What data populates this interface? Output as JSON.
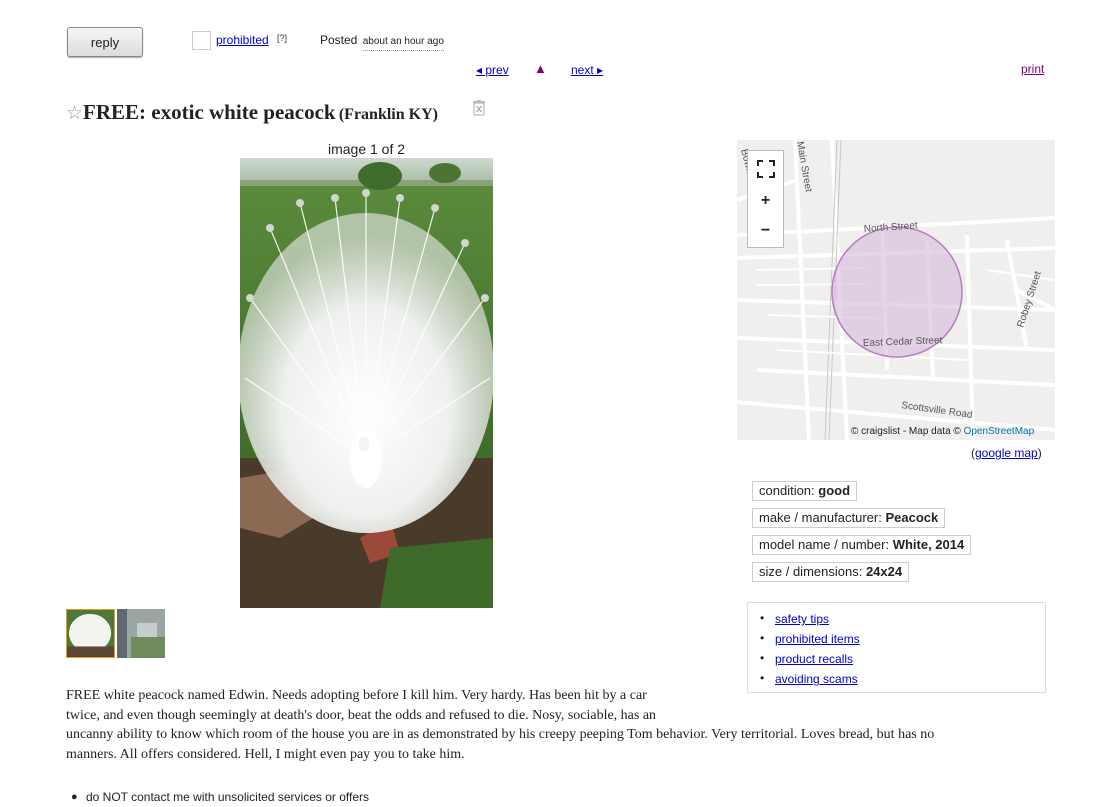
{
  "header": {
    "reply_label": "reply",
    "flag_label": "prohibited",
    "flag_help": "[?]",
    "posted_label": "Posted",
    "posted_time": "about an hour ago"
  },
  "nav": {
    "prev": "◂ prev",
    "up": "▲",
    "next": "next ▸",
    "print": "print"
  },
  "posting": {
    "star": "☆",
    "title": "FREE: exotic white peacock",
    "location": "(Franklin KY)"
  },
  "gallery": {
    "counter": "image 1 of 2"
  },
  "map": {
    "street_labels": [
      "Main Street",
      "North Street",
      "East Cedar Street",
      "Robey Street",
      "Scottsville Road",
      "Bowling Rd"
    ],
    "fullscreen_icon": "fullscreen-icon",
    "zoom_in": "+",
    "zoom_out": "−",
    "attribution_prefix": "© craigslist - Map data ©",
    "attribution_link": "OpenStreetMap",
    "google_open": "(",
    "google_link": "google map",
    "google_close": ")"
  },
  "attributes": [
    {
      "label": "condition:",
      "value": "good"
    },
    {
      "label": "make / manufacturer:",
      "value": "Peacock"
    },
    {
      "label": "model name / number:",
      "value": "White, 2014"
    },
    {
      "label": "size / dimensions:",
      "value": "24x24"
    }
  ],
  "notices": [
    "safety tips",
    "prohibited items",
    "product recalls",
    "avoiding scams"
  ],
  "body": {
    "lines": [
      "FREE white peacock named Edwin. Needs adopting before I kill him. Very hardy. Has been hit by a car",
      "twice, and even though seemingly at death's door, beat the odds and refused to die. Nosy, sociable, has an",
      "uncanny ability to know which room of the house you are in as demonstrated by his creepy peeping Tom behavior. Very territorial. Loves bread, but has no",
      "manners. All offers considered. Hell, I might even pay you to take him."
    ],
    "contact_note": "do NOT contact me with unsolicited services or offers"
  }
}
